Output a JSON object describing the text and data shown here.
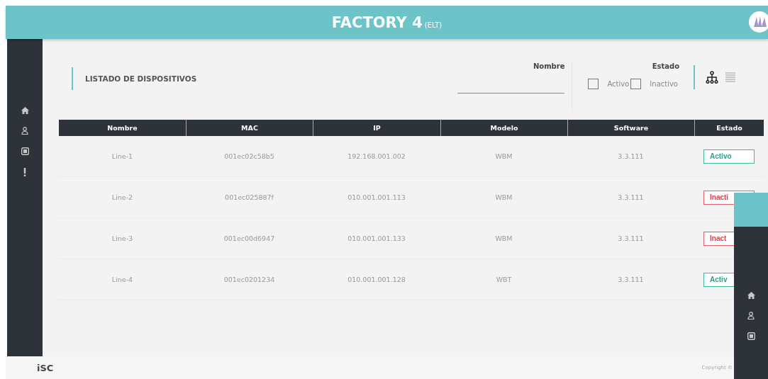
{
  "header": {
    "title": "FACTORY 4",
    "subtitle": "(ELT)"
  },
  "page_title": "LISTADO DE DISPOSITIVOS",
  "filters": {
    "name_label": "Nombre",
    "state_label": "Estado",
    "options": [
      {
        "label": "Activo",
        "checked": false
      },
      {
        "label": "Inactivo",
        "checked": false
      }
    ],
    "views": [
      {
        "kind": "tree",
        "selected": true
      },
      {
        "kind": "list",
        "selected": false
      }
    ]
  },
  "table": {
    "columns": [
      "Nombre",
      "MAC",
      "IP",
      "Modelo",
      "Software",
      "Estado"
    ],
    "rows": [
      {
        "cells": [
          "Line-1",
          "001ec02c58b5",
          "192.168.001.002",
          "WBM",
          "3.3.111"
        ],
        "status": "Activo",
        "active": true
      },
      {
        "cells": [
          "Line-2",
          "001ec025887f",
          "010.001.001.113",
          "WBM",
          "3.3.111"
        ],
        "status": "Inacti",
        "active": false
      },
      {
        "cells": [
          "Line-3",
          "001ec00d6947",
          "010.001.001.133",
          "WBM",
          "3.3.111"
        ],
        "status": "Inact",
        "active": false
      },
      {
        "cells": [
          "Line-4",
          "001ec0201234",
          "010.001.001.128",
          "WBT",
          "3.3.111"
        ],
        "status": "Activ",
        "active": true
      }
    ]
  },
  "footer": {
    "logo": "iSC",
    "copyright": "Copyright ©"
  }
}
